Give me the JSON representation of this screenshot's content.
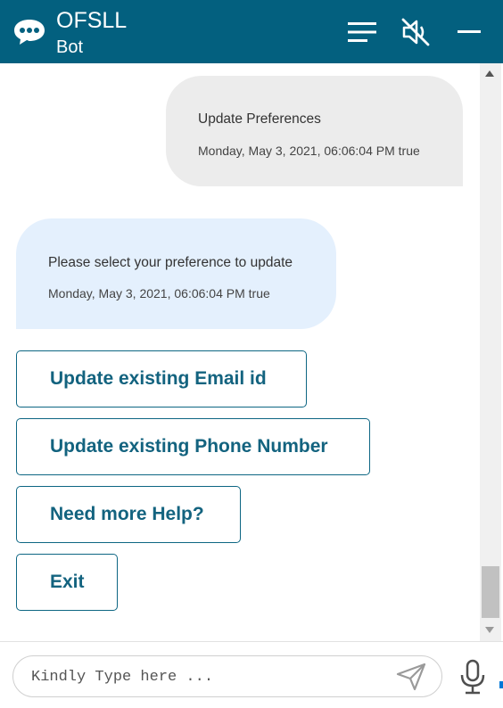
{
  "header": {
    "title": "OFSLL",
    "subtitle": "Bot",
    "icons": {
      "bot": "chat-bubble-icon",
      "menu": "hamburger-menu-icon",
      "mute": "speaker-muted-icon",
      "minimize": "minimize-icon"
    },
    "background_color": "#03607f"
  },
  "conversation": {
    "user_message": {
      "text": "Update Preferences",
      "timestamp": "Monday, May 3, 2021, 06:06:04 PM true"
    },
    "bot_message": {
      "text": "Please select your preference to update",
      "timestamp": "Monday, May 3, 2021, 06:06:04 PM true"
    },
    "actions": [
      {
        "label": "Update existing Email id"
      },
      {
        "label": "Update existing Phone Number"
      },
      {
        "label": "Need more Help?"
      },
      {
        "label": "Exit"
      }
    ],
    "colors": {
      "user_bubble": "#ececec",
      "bot_bubble": "#e4f0fd",
      "action_text": "#13637f"
    }
  },
  "footer": {
    "input_placeholder": "Kindly Type here ...",
    "input_value": "",
    "icons": {
      "send": "send-paper-plane-icon",
      "mic": "microphone-icon"
    }
  }
}
